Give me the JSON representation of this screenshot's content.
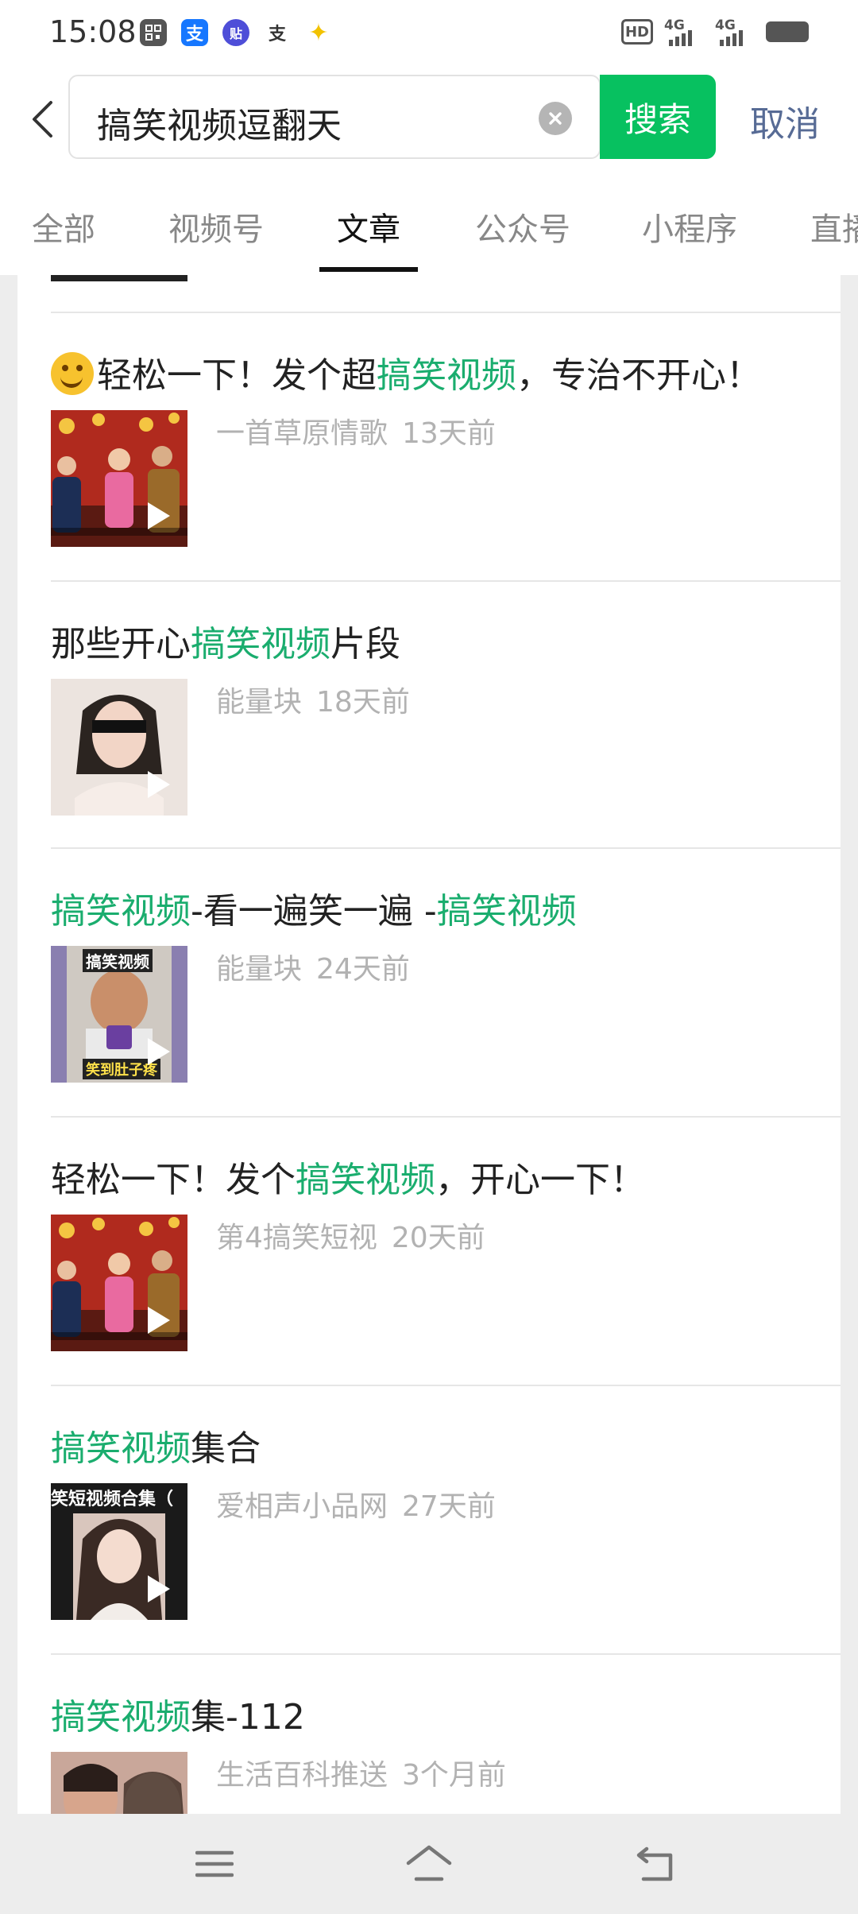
{
  "status_bar": {
    "time": "15:08",
    "apps": [
      {
        "icon": "app-icon-qr",
        "color": "#555555",
        "glyph": "▦"
      },
      {
        "icon": "alipay-icon",
        "color": "#1677ff",
        "glyph": "支"
      },
      {
        "icon": "tieba-icon",
        "color": "#4e4ed8",
        "glyph": "贴"
      },
      {
        "icon": "alipay-outline-icon",
        "color": "#ffffff",
        "glyph": "支"
      },
      {
        "icon": "rabbit-icon",
        "color": "#f2c200",
        "glyph": "✦"
      }
    ],
    "hd_label": "HD",
    "sim1_label": "4G",
    "sim2_label": "4G"
  },
  "search": {
    "back_icon": "chevron-left-icon",
    "query": "搞笑视频逗翻天",
    "clear_icon": "clear-icon",
    "search_button": "搜索",
    "cancel": "取消",
    "accent_color": "#07c160"
  },
  "tabs": [
    {
      "label": "全部",
      "active": false
    },
    {
      "label": "视频号",
      "active": false
    },
    {
      "label": "文章",
      "active": true
    },
    {
      "label": "公众号",
      "active": false
    },
    {
      "label": "小程序",
      "active": false
    },
    {
      "label": "直播",
      "active": false
    }
  ],
  "highlight_color": "#1aad6e",
  "articles": [
    {
      "title_parts": [
        "轻松一下！发个超",
        "搞笑视频",
        "，专治不开心！"
      ],
      "has_emoji": true,
      "source": "一首草原情歌",
      "time": "13天前",
      "thumb_icon": "video-thumbnail-stage"
    },
    {
      "title_parts": [
        "那些开心",
        "搞笑视频",
        "片段"
      ],
      "has_emoji": false,
      "source": "能量块",
      "time": "18天前",
      "thumb_icon": "video-thumbnail-woman"
    },
    {
      "title_parts": [
        "",
        "搞笑视频",
        "-看一遍笑一遍 -",
        "搞笑视频"
      ],
      "has_emoji": false,
      "source": "能量块",
      "time": "24天前",
      "thumb_icon": "video-thumbnail-eating",
      "thumb_caption_top": "搞笑视频",
      "thumb_caption_bottom": "笑到肚子疼"
    },
    {
      "title_parts": [
        "轻松一下！发个",
        "搞笑视频",
        "，开心一下！"
      ],
      "has_emoji": false,
      "source": "第4搞笑短视",
      "time": "20天前",
      "thumb_icon": "video-thumbnail-stage"
    },
    {
      "title_parts": [
        "",
        "搞笑视频",
        "集合"
      ],
      "has_emoji": false,
      "source": "爱相声小品网",
      "time": "27天前",
      "thumb_icon": "video-thumbnail-girl",
      "thumb_caption_top": "笑短视频合集（"
    },
    {
      "title_parts": [
        "",
        "搞笑视频",
        "集-112"
      ],
      "has_emoji": false,
      "source": "生活百科推送",
      "time": "3个月前",
      "thumb_icon": "video-thumbnail-couple"
    }
  ],
  "nav": {
    "menu_icon": "menu-icon",
    "home_icon": "home-icon",
    "back_icon": "back-icon"
  }
}
